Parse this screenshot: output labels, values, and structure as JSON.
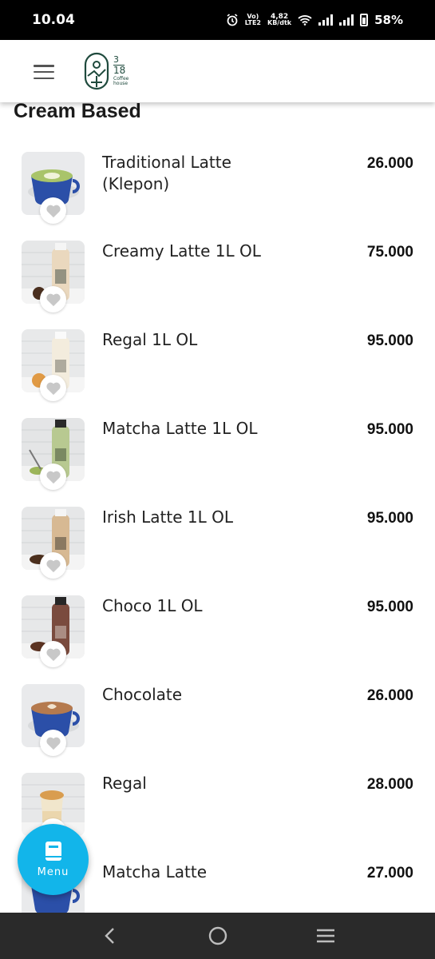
{
  "status_bar": {
    "time": "10.04",
    "network_top": "Vo)",
    "network_bottom": "LTE2",
    "speed_top": "4,82",
    "speed_bottom": "KB/dtk",
    "battery": "58%"
  },
  "header": {
    "logo_number_top": "3",
    "logo_number_bottom": "18",
    "logo_line1": "Coffee",
    "logo_line2": "house"
  },
  "section": {
    "title": "Cream Based"
  },
  "items": [
    {
      "name": "Traditional Latte (Klepon)",
      "price": "26.000",
      "thumb": "matcha-cup"
    },
    {
      "name": "Creamy Latte 1L OL",
      "price": "75.000",
      "thumb": "bottle-beige"
    },
    {
      "name": "Regal 1L OL",
      "price": "95.000",
      "thumb": "bottle-cream"
    },
    {
      "name": "Matcha Latte 1L OL",
      "price": "95.000",
      "thumb": "bottle-green"
    },
    {
      "name": "Irish Latte 1L OL",
      "price": "95.000",
      "thumb": "bottle-tan"
    },
    {
      "name": "Choco 1L OL",
      "price": "95.000",
      "thumb": "bottle-brown"
    },
    {
      "name": "Chocolate",
      "price": "26.000",
      "thumb": "coffee-cup"
    },
    {
      "name": "Regal",
      "price": "28.000",
      "thumb": "glass-drink"
    },
    {
      "name": "Matcha Latte",
      "price": "27.000",
      "thumb": "matcha-cup"
    }
  ],
  "fab": {
    "label": "Menu",
    "icon": "book-icon"
  },
  "colors": {
    "accent": "#12b5ea",
    "favorite_icon": "#c8c8c8",
    "logo": "#1f4a3d"
  }
}
